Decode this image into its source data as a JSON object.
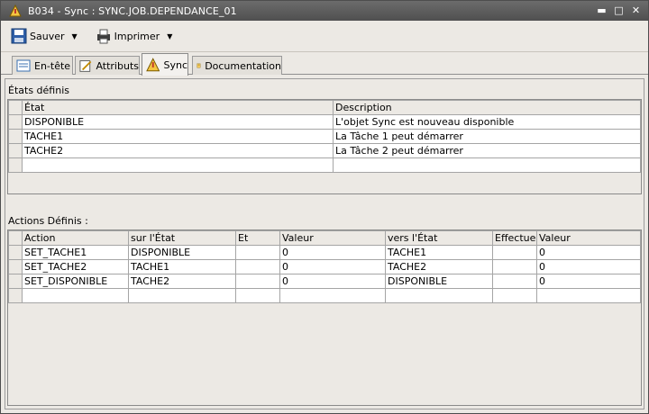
{
  "window": {
    "title": "B034 - Sync : SYNC.JOB.DEPENDANCE_01"
  },
  "toolbar": {
    "save_label": "Sauver",
    "print_label": "Imprimer"
  },
  "tabs": [
    {
      "label": "En-tête",
      "icon": "header-icon"
    },
    {
      "label": "Attributs",
      "icon": "attributes-icon"
    },
    {
      "label": "Sync",
      "icon": "sync-icon",
      "active": true
    },
    {
      "label": "Documentation",
      "icon": "documentation-icon"
    }
  ],
  "states": {
    "label": "États définis",
    "columns": [
      "État",
      "Description"
    ],
    "rows": [
      [
        "DISPONIBLE",
        "L'objet Sync est nouveau disponible"
      ],
      [
        "TACHE1",
        "La Tâche 1 peut démarrer"
      ],
      [
        "TACHE2",
        "La Tâche 2 peut démarrer"
      ]
    ]
  },
  "actions": {
    "label": "Actions Définis :",
    "columns": [
      "Action",
      "sur l'État",
      "Et",
      "Valeur",
      "vers l'État",
      "Effectuer",
      "Valeur"
    ],
    "rows": [
      [
        "SET_TACHE1",
        "DISPONIBLE",
        "",
        "0",
        "TACHE1",
        "",
        "0"
      ],
      [
        "SET_TACHE2",
        "TACHE1",
        "",
        "0",
        "TACHE2",
        "",
        "0"
      ],
      [
        "SET_DISPONIBLE",
        "TACHE2",
        "",
        "0",
        "DISPONIBLE",
        "",
        "0"
      ]
    ]
  }
}
